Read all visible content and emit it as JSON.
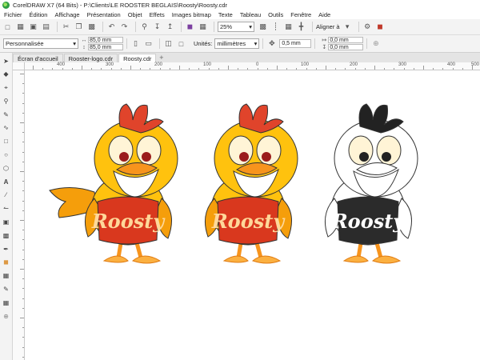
{
  "window": {
    "title": "CorelDRAW X7 (64 Bits) - P:\\Clients\\LE ROOSTER BEGLAIS\\Roosty\\Roosty.cdr"
  },
  "menu": [
    "Fichier",
    "Édition",
    "Affichage",
    "Présentation",
    "Objet",
    "Effets",
    "Images bitmap",
    "Texte",
    "Tableau",
    "Outils",
    "Fenêtre",
    "Aide"
  ],
  "toolbar": {
    "zoom": "25%",
    "align_label": "Aligner à"
  },
  "propbar": {
    "page_size": "Personnalisée",
    "width": "85,0 mm",
    "height": "85,0 mm",
    "units_label": "Unités:",
    "units": "millimètres",
    "nudge": "0,5 mm",
    "dup_x": "0,0 mm",
    "dup_y": "0,0 mm"
  },
  "tabs": [
    {
      "label": "Écran d'accueil",
      "active": false
    },
    {
      "label": "Rooster-logo.cdr",
      "active": false
    },
    {
      "label": "Roosty.cdr",
      "active": true
    }
  ],
  "ruler": {
    "labels": [
      "400",
      "300",
      "200",
      "100",
      "0",
      "100",
      "200",
      "300",
      "400",
      "500"
    ]
  },
  "artwork": {
    "shirt_text": "Roosty",
    "colors": {
      "body": "#ffc20e",
      "body_shade": "#f59e0b",
      "comb": "#e0442b",
      "shirt": "#d9381e",
      "shirt_text": "#ffd89a",
      "beak": "#f7941d",
      "pupil": "#9b1c1c",
      "bw_shirt": "#2b2b2b"
    }
  }
}
